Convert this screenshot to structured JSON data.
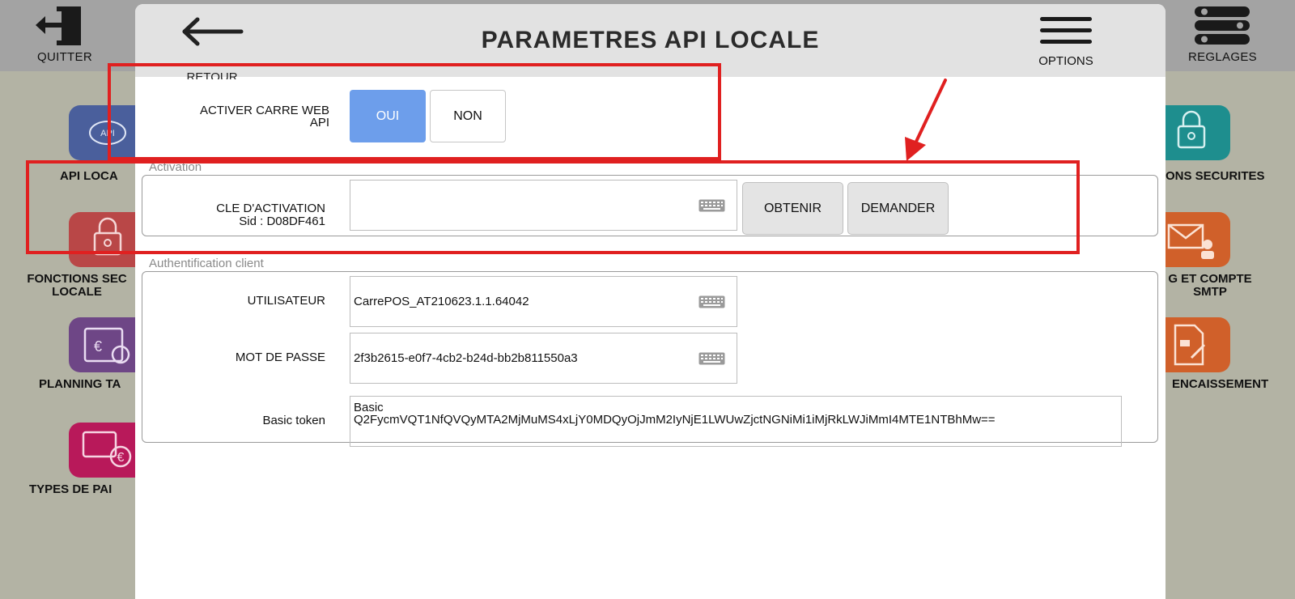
{
  "background": {
    "top_bar": {
      "quit_label": "QUITTER",
      "settings_label": "REGLAGES"
    },
    "tiles_left": [
      {
        "label": "API LOCA",
        "icon_text": "API",
        "color": "#4a5f9c"
      },
      {
        "label": "FONCTIONS SEC\nLOCALE",
        "color": "#b94747"
      },
      {
        "label": "PLANNING TA",
        "icon_text": "€",
        "color": "#6e4686"
      },
      {
        "label": "TYPES DE PAI",
        "icon_text": "€",
        "color": "#b8195a"
      }
    ],
    "tiles_right": [
      {
        "label": "ONS SECURITES",
        "color": "#1e8e8e"
      },
      {
        "label": "G ET COMPTE\nSMTP",
        "color": "#d0602a"
      },
      {
        "label": "ENCAISSEMENT",
        "color": "#d0602a"
      }
    ]
  },
  "dialog": {
    "title": "PARAMETRES API LOCALE",
    "back_label": "RETOUR",
    "options_label": "OPTIONS",
    "web_api": {
      "label": "ACTIVER CARRE WEB\nAPI",
      "yes": "OUI",
      "no": "NON",
      "selected": "OUI"
    },
    "activation": {
      "legend": "Activation",
      "key_label": "CLE D'ACTIVATION",
      "sid": "Sid : D08DF461",
      "key_value": "",
      "obtain_button": "OBTENIR",
      "request_button": "DEMANDER"
    },
    "auth": {
      "legend": "Authentification client",
      "user_label": "UTILISATEUR",
      "user_value": "CarrePOS_AT210623.1.1.64042",
      "password_label": "MOT DE PASSE",
      "password_value": "2f3b2615-e0f7-4cb2-b24d-bb2b811550a3",
      "token_label": "Basic token",
      "token_value": "Basic\nQ2FycmVQT1NfQVQyMTA2MjMuMS4xLjY0MDQyOjJmM2IyNjE1LWUwZjctNGNiMi1iMjRkLWJiMmI4MTE1NTBhMw=="
    }
  },
  "colors": {
    "annotation": "#e02020",
    "toggle_on": "#6d9eeb"
  }
}
